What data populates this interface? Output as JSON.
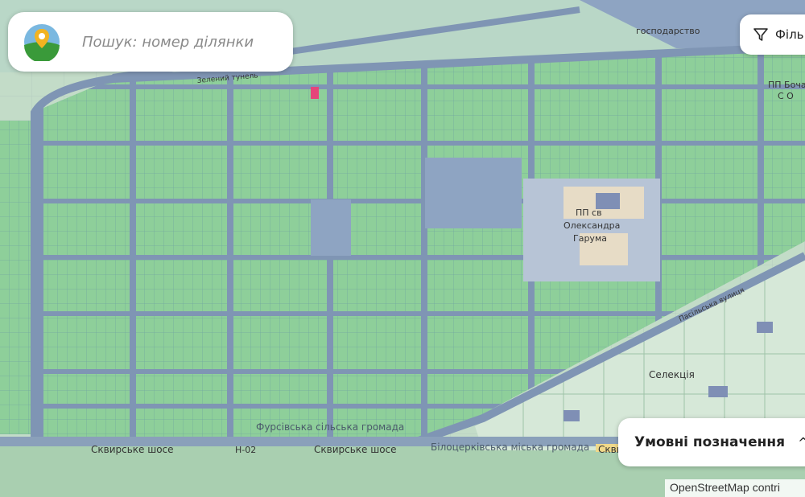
{
  "search": {
    "placeholder": "Пошук: номер ділянки"
  },
  "filter": {
    "label": "Філь"
  },
  "legend": {
    "label": "Умовні позначення"
  },
  "attribution": {
    "text": "OpenStreetMap contri"
  },
  "map_labels": {
    "zeleniy_tunel": "Зелений тунель",
    "fursivska": "Фурсівська сільська громада",
    "bilotserkivska": "Білоцерківська міська громада",
    "skvyrske_left": "Сквирське шосе",
    "skvyrske_mid": "Сквирське шосе",
    "skvyrske_right": "Скви",
    "h02": "Н-02",
    "seleksia": "Селекція",
    "pp_top": "ПП Бочар",
    "pp_top2": "С О",
    "vasylska": "Пасільська вулиця",
    "gospodarstvo": "господарство",
    "pp_center": "ПП св",
    "pp_center2": "Олександра",
    "pp_center3": "Гарума"
  },
  "colors": {
    "parcel": "#8ecf9a",
    "road": "#7f95b4",
    "background": "#cfe3cf",
    "highlight": "#e6457a"
  },
  "icons": {
    "logo": "map-pin-logo-icon",
    "filter": "funnel-icon",
    "chevron": "chevron-up-icon"
  }
}
